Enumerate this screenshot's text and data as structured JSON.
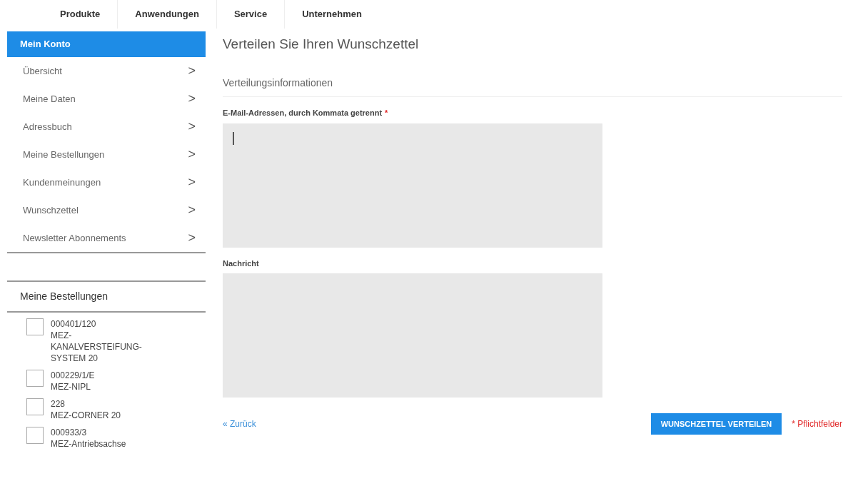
{
  "top_nav": [
    {
      "label": "Produkte"
    },
    {
      "label": "Anwendungen"
    },
    {
      "label": "Service"
    },
    {
      "label": "Unternehmen"
    }
  ],
  "sidebar": {
    "title": "Mein Konto",
    "items": [
      {
        "label": "Übersicht",
        "arrow": ">"
      },
      {
        "label": "Meine Daten",
        "arrow": ">"
      },
      {
        "label": "Adressbuch",
        "arrow": ">"
      },
      {
        "label": "Meine Bestellungen",
        "arrow": ">"
      },
      {
        "label": "Kundenmeinungen",
        "arrow": ">"
      },
      {
        "label": "Wunschzettel",
        "arrow": ">"
      },
      {
        "label": "Newsletter Abonnements",
        "arrow": ">"
      }
    ]
  },
  "orders": {
    "title": "Meine Bestellungen",
    "items": [
      {
        "lines": [
          "000401/120",
          "MEZ-",
          "KANALVERSTEIFUNG-",
          "SYSTEM 20"
        ],
        "checked": false
      },
      {
        "lines": [
          "000229/1/E",
          "MEZ-NIPL"
        ],
        "checked": false
      },
      {
        "lines": [
          "228",
          "MEZ-CORNER 20"
        ],
        "checked": false
      },
      {
        "lines": [
          "000933/3",
          "MEZ-Antriebsachse"
        ],
        "checked": false
      }
    ]
  },
  "main": {
    "title": "Verteilen Sie Ihren Wunschzettel",
    "section": "Verteilungsinformationen",
    "fields": [
      {
        "label": "E-Mail-Adressen, durch Kommata getrennt",
        "required_mark": "*",
        "focused": true
      },
      {
        "label": "Nachricht",
        "focused": false
      }
    ],
    "back_link": "« Zurück",
    "submit": "WUNSCHZETTEL VERTEILEN",
    "required_note": "* Pflichtfelder"
  }
}
